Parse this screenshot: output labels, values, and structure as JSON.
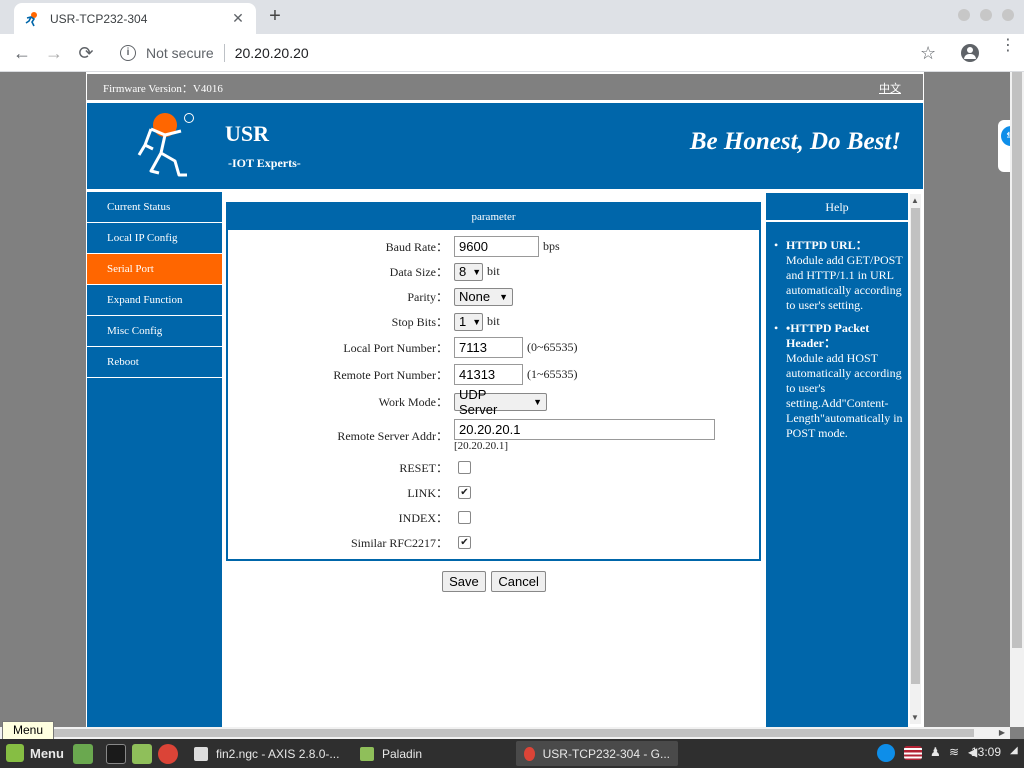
{
  "browser": {
    "tab_title": "USR-TCP232-304",
    "tab_close": "✕",
    "new_tab": "+",
    "security_label": "Not secure",
    "url": "20.20.20.20",
    "nav": {
      "back": "←",
      "forward": "→",
      "reload": "⟳"
    },
    "info_glyph": "i",
    "star_glyph": "☆",
    "kebab_glyph": "⋮"
  },
  "page": {
    "firmware": "Firmware Version：V4016",
    "lang_link": "中文",
    "brand": "USR",
    "brand_sub": "-IOT Experts-",
    "slogan": "Be Honest, Do Best!",
    "nav_items": [
      {
        "label": "Current Status",
        "active": false
      },
      {
        "label": "Local IP Config",
        "active": false
      },
      {
        "label": "Serial Port",
        "active": true
      },
      {
        "label": "Expand Function",
        "active": false
      },
      {
        "label": "Misc Config",
        "active": false
      },
      {
        "label": "Reboot",
        "active": false
      }
    ],
    "panel_title": "parameter",
    "fields": {
      "baud_rate": {
        "label": "Baud Rate：",
        "value": "9600",
        "unit": "bps"
      },
      "data_size": {
        "label": "Data Size：",
        "value": "8",
        "unit": "bit"
      },
      "parity": {
        "label": "Parity：",
        "value": "None"
      },
      "stop_bits": {
        "label": "Stop Bits：",
        "value": "1",
        "unit": "bit"
      },
      "local_port": {
        "label": "Local Port Number：",
        "value": "7113",
        "range": "(0~65535)"
      },
      "remote_port": {
        "label": "Remote Port Number：",
        "value": "41313",
        "range": "(1~65535)"
      },
      "work_mode": {
        "label": "Work Mode：",
        "value": "UDP Server"
      },
      "remote_addr": {
        "label": "Remote Server Addr：",
        "value": "20.20.20.1",
        "current": "[20.20.20.1]"
      },
      "reset": {
        "label": "RESET：",
        "checked": false
      },
      "link": {
        "label": "LINK：",
        "checked": true
      },
      "index": {
        "label": "INDEX：",
        "checked": false
      },
      "rfc2217": {
        "label": "Similar RFC2217：",
        "checked": true
      }
    },
    "check_glyph": "✔",
    "select_arrow": "▼",
    "save_label": "Save",
    "cancel_label": "Cancel",
    "help": {
      "title": "Help",
      "items": [
        {
          "heading": "HTTPD URL：",
          "text": "Module add GET/POST and HTTP/1.1 in URL automatically according to user's setting."
        },
        {
          "heading": "•HTTPD Packet Header：",
          "text": "Module add HOST automatically according to user's setting.Add\"Content-Length\"automatically in POST mode."
        }
      ]
    }
  },
  "taskbar": {
    "tooltip": "Menu",
    "menu_label": "Menu",
    "windows": [
      {
        "label": "fin2.ngc - AXIS 2.8.0-...",
        "active": false
      },
      {
        "label": "Paladin",
        "active": false
      },
      {
        "label": "USR-TCP232-304 - G...",
        "active": true
      }
    ],
    "clock": "13:09"
  },
  "colors": {
    "brand_blue": "#0066aa",
    "active_orange": "#ff6600",
    "logo_orange": "#ff6600"
  }
}
